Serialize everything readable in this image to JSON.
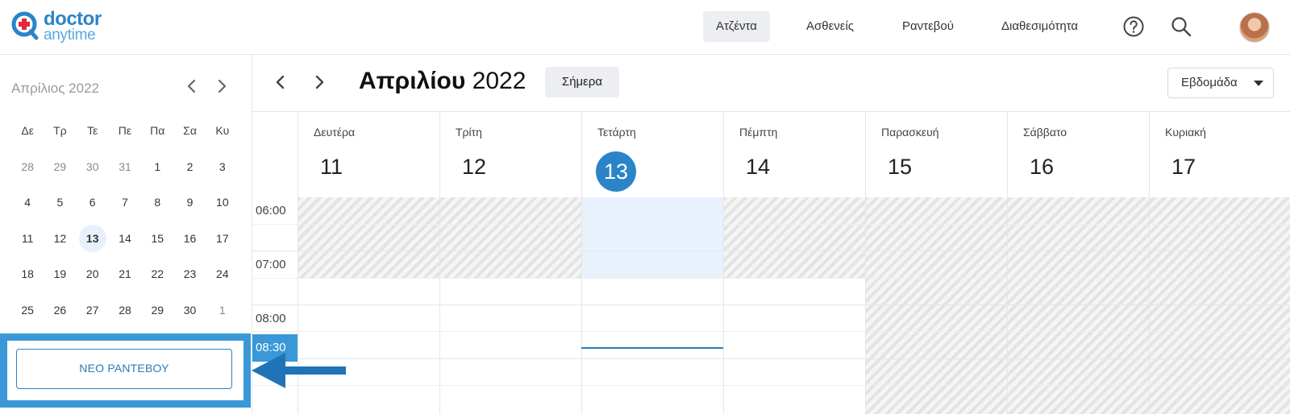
{
  "brand": {
    "name_top": "doctor",
    "name_bottom": "anytime",
    "primary": "#2b84c7",
    "accent": "#3a97d8"
  },
  "nav": {
    "items": [
      "Ατζέντα",
      "Ασθενείς",
      "Ραντεβού",
      "Διαθεσιμότητα"
    ],
    "active_index": 0
  },
  "header_icons": [
    "help-icon",
    "search-icon",
    "avatar"
  ],
  "mini_calendar": {
    "title": "Απρίλιος 2022",
    "weekdays": [
      "Δε",
      "Τρ",
      "Τε",
      "Πε",
      "Πα",
      "Σα",
      "Κυ"
    ],
    "weeks": [
      [
        "28",
        "29",
        "30",
        "31",
        "1",
        "2",
        "3"
      ],
      [
        "4",
        "5",
        "6",
        "7",
        "8",
        "9",
        "10"
      ],
      [
        "11",
        "12",
        "13",
        "14",
        "15",
        "16",
        "17"
      ],
      [
        "18",
        "19",
        "20",
        "21",
        "22",
        "23",
        "24"
      ],
      [
        "25",
        "26",
        "27",
        "28",
        "29",
        "30",
        "1"
      ]
    ],
    "today": "13"
  },
  "new_appointment_label": "ΝΕΟ ΡΑΝΤΕΒΟΥ",
  "calendar": {
    "title_month": "Απριλίου",
    "title_year": "2022",
    "today_label": "Σήμερα",
    "view_label": "Εβδομάδα",
    "days": [
      {
        "name": "Δευτέρα",
        "num": "11"
      },
      {
        "name": "Τρίτη",
        "num": "12"
      },
      {
        "name": "Τετάρτη",
        "num": "13",
        "today": true
      },
      {
        "name": "Πέμπτη",
        "num": "14"
      },
      {
        "name": "Παρασκευή",
        "num": "15"
      },
      {
        "name": "Σάββατο",
        "num": "16"
      },
      {
        "name": "Κυριακή",
        "num": "17"
      }
    ],
    "times": [
      "06:00",
      "07:00",
      "08:00"
    ],
    "current_time": "08:30"
  }
}
